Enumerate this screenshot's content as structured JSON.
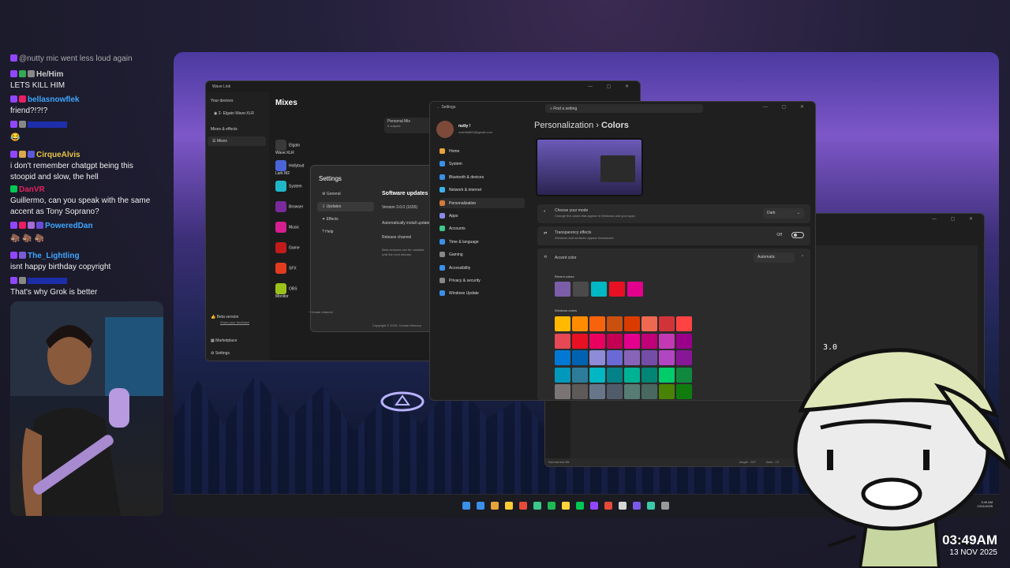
{
  "chat": [
    {
      "badges": [
        "#9146ff"
      ],
      "name": "",
      "text": "@nutty mic went less loud again",
      "color": "#aaa"
    },
    {
      "badges": [
        "#9146ff",
        "#34a853",
        "#888"
      ],
      "name": "He/Him",
      "name_color": "#ccc",
      "tag": "",
      "text": ""
    },
    {
      "badges": [],
      "name": "",
      "text": "LETS KILL HIM",
      "color": "#eee"
    },
    {
      "badges": [
        "#9146ff",
        "#e91e63"
      ],
      "name": "bellasnowflek",
      "name_color": "#3ea6ff",
      "text": ""
    },
    {
      "badges": [],
      "name": "",
      "text": "friend?!?!?",
      "color": "#eee"
    },
    {
      "badges": [
        "#9146ff",
        "#888"
      ],
      "name": "",
      "name_color": "#1e3cff",
      "text": ""
    },
    {
      "badges": [],
      "name": "",
      "text": "😂",
      "color": "#eee"
    },
    {
      "badges": [
        "#9146ff",
        "#d9a84c",
        "#5a5ad6"
      ],
      "name": "CirqueAlvis",
      "name_color": "#e8c547",
      "text": ""
    },
    {
      "badges": [],
      "name": "",
      "text": "i don't remember chatgpt being this",
      "color": "#eee"
    },
    {
      "badges": [],
      "name": "",
      "text": "stoopid and slow, the hell",
      "color": "#eee"
    },
    {
      "badges": [
        "#00c853"
      ],
      "name": "DanVR",
      "name_color": "#e0245e",
      "text": ""
    },
    {
      "badges": [],
      "name": "",
      "text": "Guillermo, can you speak with the same",
      "color": "#eee"
    },
    {
      "badges": [],
      "name": "",
      "text": "accent as Tony Soprano?",
      "color": "#eee"
    },
    {
      "badges": [
        "#9146ff",
        "#e91e63",
        "#a56bd6",
        "#6a4bd6"
      ],
      "name": "PoweredDan",
      "name_color": "#3ea6ff",
      "text": ""
    },
    {
      "badges": [],
      "name": "",
      "text": "🦣 🦣 🦣",
      "color": "#eee"
    },
    {
      "badges": [
        "#9146ff",
        "#7b5bd6"
      ],
      "name": "The_Lightling",
      "name_color": "#3ea6ff",
      "text": ""
    },
    {
      "badges": [],
      "name": "",
      "text": "isnt happy birthday copyright",
      "color": "#eee"
    },
    {
      "badges": [
        "#9146ff",
        "#888"
      ],
      "name": "",
      "name_color": "#1e3cff",
      "text": ""
    },
    {
      "badges": [],
      "name": "",
      "text": "That's why Grok is better",
      "color": "#eee"
    }
  ],
  "wavelink": {
    "title": "Wave Link",
    "your_devices": "Your devices",
    "device": "2- Elgato Wave:XLR",
    "mixes_effects": "Mixes & effects",
    "mixes": "Mixes",
    "heading": "Mixes",
    "personal_mix": "Personal Mix",
    "outputs": "6 outputs",
    "channels": [
      {
        "label": "Elgato Wave:XLR",
        "color": "#3a3a3a"
      },
      {
        "label": "Hollybud Lark M2",
        "color": "#4a66d6"
      },
      {
        "label": "System",
        "color": "#20b6c9"
      },
      {
        "label": "Browser",
        "color": "#7a2a9c"
      },
      {
        "label": "Music",
        "color": "#d61f8f"
      },
      {
        "label": "Game",
        "color": "#c21b1b"
      },
      {
        "label": "SFX",
        "color": "#e23b1e"
      },
      {
        "label": "OBS Monitor",
        "color": "#9ac21b"
      }
    ],
    "beta": "Beta version",
    "feedback": "Share your feedback",
    "marketplace": "Marketplace",
    "settings": "Settings",
    "dialog": {
      "title": "Settings",
      "nav": [
        "General",
        "Updates",
        "Effects",
        "Help"
      ],
      "heading": "Software updates",
      "version": "Version 3.0.0 (1635)",
      "auto": "Automatically install updates",
      "release": "Release channel",
      "note1": "Beta versions can be unstable",
      "note2": "until the next release.",
      "copyright": "Copyright © 2025, Corsair Memory",
      "create": "+ Create channel"
    }
  },
  "winsettings": {
    "title": "Settings",
    "user": "nutty !",
    "email": "nutella5600@gmail.com",
    "search": "Find a setting",
    "nav": [
      {
        "label": "Home",
        "color": "#e8a33a"
      },
      {
        "label": "System",
        "color": "#3a8fe8"
      },
      {
        "label": "Bluetooth & devices",
        "color": "#3a8fe8"
      },
      {
        "label": "Network & internet",
        "color": "#3ab3e8"
      },
      {
        "label": "Personalization",
        "color": "#d67a3a"
      },
      {
        "label": "Apps",
        "color": "#8a8ae8"
      },
      {
        "label": "Accounts",
        "color": "#3ac98a"
      },
      {
        "label": "Time & language",
        "color": "#3a8fe8"
      },
      {
        "label": "Gaming",
        "color": "#888"
      },
      {
        "label": "Accessibility",
        "color": "#3a8fe8"
      },
      {
        "label": "Privacy & security",
        "color": "#888"
      },
      {
        "label": "Windows Update",
        "color": "#3a8fe8"
      }
    ],
    "breadcrumb_parent": "Personalization",
    "breadcrumb_sep": "›",
    "breadcrumb_current": "Colors",
    "mode_title": "Choose your mode",
    "mode_desc": "Change the colors that appear in Windows and your apps",
    "mode_value": "Dark",
    "transp_title": "Transparency effects",
    "transp_desc": "Windows and surfaces appear translucent",
    "transp_value": "Off",
    "accent_title": "Accent color",
    "accent_value": "Automatic",
    "recent_label": "Recent colors",
    "recent": [
      "#7b5ea7",
      "#4a4a4a",
      "#00b7c3",
      "#e81123",
      "#e3008c"
    ],
    "windows_label": "Windows colors",
    "palette": [
      [
        "#ffb900",
        "#ff8c00",
        "#f7630c",
        "#ca5010",
        "#da3b01",
        "#ef6950",
        "#d13438",
        "#ff4343"
      ],
      [
        "#e74856",
        "#e81123",
        "#ea005e",
        "#c30052",
        "#e3008c",
        "#bf0077",
        "#c239b3",
        "#9a0089"
      ],
      [
        "#0078d4",
        "#0063b1",
        "#8e8cd8",
        "#6b69d6",
        "#8764b8",
        "#744da9",
        "#b146c2",
        "#881798"
      ],
      [
        "#0099bc",
        "#2d7d9a",
        "#00b7c3",
        "#038387",
        "#00b294",
        "#018574",
        "#00cc6a",
        "#10893e"
      ],
      [
        "#7a7574",
        "#5d5a58",
        "#68768a",
        "#515c6b",
        "#567c73",
        "#486860",
        "#498205",
        "#107c10"
      ]
    ]
  },
  "notepad": {
    "text": "3.0",
    "status": "Normal text file",
    "length": "length : 207",
    "lines": "lines : 13"
  },
  "taskbar_icons": [
    "#3a8fe8",
    "#e8a33a",
    "#ffcc33",
    "#e84a3a",
    "#3ac98a",
    "#1db954",
    "#ffd43a",
    "#00c853",
    "#9146ff",
    "#e84a3a",
    "#d6d6d6",
    "#7a5ae8",
    "#3ac9a8",
    "#999"
  ],
  "tray_time": "3:49 AM",
  "tray_date": "13/11/2025",
  "clock": {
    "time": "03:49AM",
    "date": "13 NOV 2025"
  }
}
